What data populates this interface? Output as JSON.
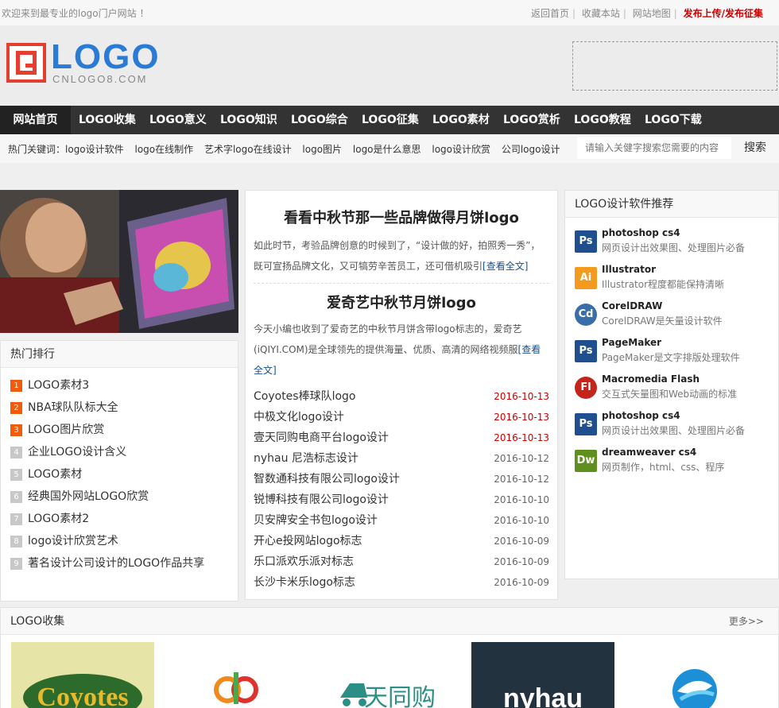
{
  "topbar": {
    "welcome": "欢迎来到最专业的logo门户网站 ！",
    "links": [
      "返回首页",
      "收藏本站",
      "网站地图"
    ],
    "highlight": "发布上传/发布征集"
  },
  "header": {
    "logo_text": "LOGO",
    "logo_sub": "CNLOGO8.COM"
  },
  "nav": {
    "items": [
      "网站首页",
      "LOGO收集",
      "LOGO意义",
      "LOGO知识",
      "LOGO综合",
      "LOGO征集",
      "LOGO素材",
      "LOGO赏析",
      "LOGO教程",
      "LOGO下载"
    ]
  },
  "hot": {
    "label": "热门关键词：",
    "keywords": [
      "logo设计软件",
      "logo在线制作",
      "艺术字logo在线设计",
      "logo图片",
      "logo是什么意思",
      "logo设计欣赏",
      "公司logo设计"
    ]
  },
  "search": {
    "placeholder": "请输入关健字搜索您需要的内容",
    "button": "搜索"
  },
  "ranking": {
    "title": "热门排行",
    "items": [
      "LOGO素材3",
      "NBA球队队标大全",
      "LOGO图片欣赏",
      "企业LOGO设计含义",
      "LOGO素材",
      "经典国外网站LOGO欣赏",
      "LOGO素材2",
      "logo设计欣赏艺术",
      "著名设计公司设计的LOGO作品共享"
    ]
  },
  "featured": [
    {
      "title": "看看中秋节那一些品牌做得月饼logo",
      "desc": "如此时节，考验品牌创意的时候到了，“设计做的好，拍照秀一秀”，既可宣扬品牌文化，又可犒劳辛苦员工，还可借机吸引",
      "more": "[查看全文]"
    },
    {
      "title": "爱奇艺中秋节月饼logo",
      "desc": "今天小编也收到了爱奇艺的中秋节月饼含带logo标志的，爱奇艺(iQIYI.COM)是全球领先的提供海量、优质、高清的网络视频服",
      "more": "[查看全文]"
    }
  ],
  "news": [
    {
      "title": "Coyotes棒球队logo",
      "date": "2016-10-13"
    },
    {
      "title": "中极文化logo设计",
      "date": "2016-10-13"
    },
    {
      "title": "壹天同购电商平台logo设计",
      "date": "2016-10-13"
    },
    {
      "title": "nyhau 尼浩标志设计",
      "date": "2016-10-12"
    },
    {
      "title": "智数通科技有限公司logo设计",
      "date": "2016-10-12"
    },
    {
      "title": "锐博科技有限公司logo设计",
      "date": "2016-10-10"
    },
    {
      "title": "贝安牌安全书包logo设计",
      "date": "2016-10-10"
    },
    {
      "title": "开心e投网站logo标志",
      "date": "2016-10-09"
    },
    {
      "title": "乐口派欢乐派对标志",
      "date": "2016-10-09"
    },
    {
      "title": "长沙卡米乐logo标志",
      "date": "2016-10-09"
    }
  ],
  "software": {
    "title": "LOGO设计软件推荐",
    "items": [
      {
        "icon": "Ps",
        "name": "photoshop cs4",
        "desc": "网页设计出效果图、处理图片必备",
        "color": "#1f4f8f"
      },
      {
        "icon": "Ai",
        "name": "Illustrator",
        "desc": "Illustrator程度都能保持清晰",
        "color": "#f39a1f"
      },
      {
        "icon": "Cd",
        "name": "CorelDRAW",
        "desc": "CorelDRAW是矢量设计软件",
        "color": "#3a6ea8"
      },
      {
        "icon": "Ps",
        "name": "PageMaker",
        "desc": "PageMaker是文字排版处理软件",
        "color": "#1f4f8f"
      },
      {
        "icon": "Fl",
        "name": "Macromedia Flash",
        "desc": "交互式矢量图和Web动画的标准",
        "color": "#c4241b"
      },
      {
        "icon": "Ps",
        "name": "photoshop cs4",
        "desc": "网页设计出效果图、处理图片必备",
        "color": "#1f4f8f"
      },
      {
        "icon": "Dw",
        "name": "dreamweaver cs4",
        "desc": "网页制作，html、css、程序",
        "color": "#5f8f1f"
      }
    ]
  },
  "collection": {
    "title": "LOGO收集",
    "more": "更多>>",
    "thumbs": [
      "Coyotes",
      "天同购",
      "nyhau"
    ]
  }
}
